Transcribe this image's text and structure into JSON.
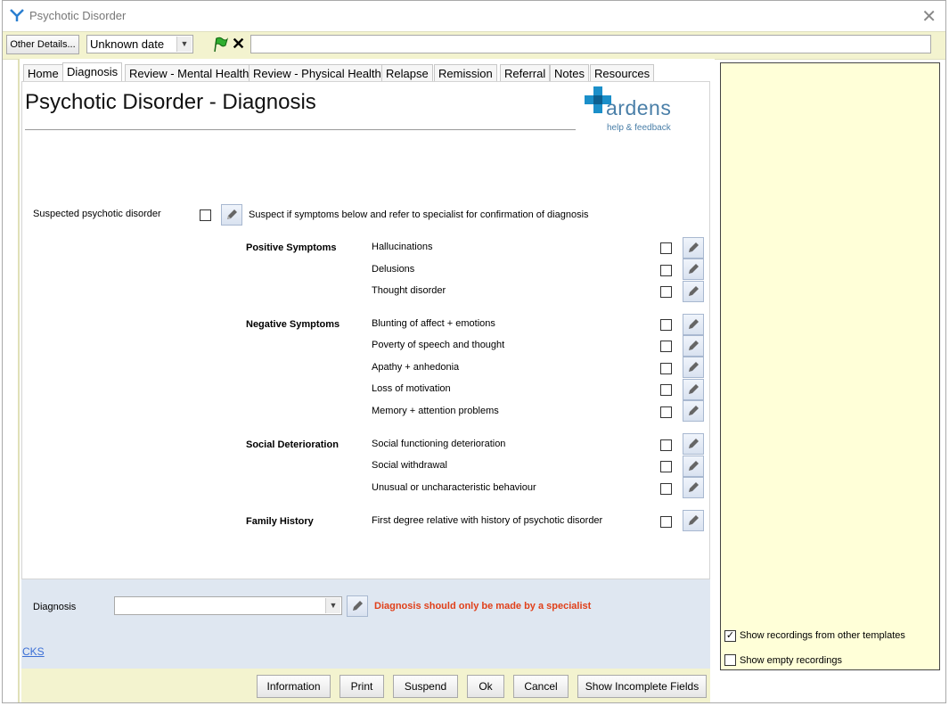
{
  "window": {
    "title": "Psychotic Disorder"
  },
  "toolbar": {
    "other_details_label": "Other Details...",
    "date_value": "Unknown date",
    "free_text_value": ""
  },
  "tabs": [
    {
      "label": "Home"
    },
    {
      "label": "Diagnosis"
    },
    {
      "label": "Review - Mental Health"
    },
    {
      "label": "Review - Physical Health"
    },
    {
      "label": "Relapse"
    },
    {
      "label": "Remission"
    },
    {
      "label": "Referral"
    },
    {
      "label": "Notes"
    },
    {
      "label": "Resources"
    }
  ],
  "active_tab": "Diagnosis",
  "page": {
    "title": "Psychotic Disorder - Diagnosis",
    "logo_text": "ardens",
    "logo_link": "help & feedback",
    "logo_color": "#4a7fa8",
    "logo_accent": "#1b8fc9"
  },
  "suspected": {
    "label": "Suspected psychotic disorder",
    "hint": "Suspect if symptoms below and refer to specialist for confirmation of diagnosis"
  },
  "groups": [
    {
      "name": "Positive Symptoms",
      "items": [
        "Hallucinations",
        "Delusions",
        "Thought disorder"
      ]
    },
    {
      "name": "Negative Symptoms",
      "items": [
        "Blunting of affect + emotions",
        "Poverty of speech and thought",
        "Apathy + anhedonia",
        "Loss of motivation",
        "Memory + attention problems"
      ]
    },
    {
      "name": "Social Deterioration",
      "items": [
        "Social functioning deterioration",
        "Social withdrawal",
        "Unusual or uncharacteristic behaviour"
      ]
    },
    {
      "name": "Family History",
      "items": [
        "First degree relative with history of psychotic disorder"
      ]
    }
  ],
  "diagnosis": {
    "label": "Diagnosis",
    "value": "",
    "warning": "Diagnosis should only be made by a specialist",
    "warning_color": "#e0401a"
  },
  "cks_link": "CKS",
  "bottom_buttons": [
    {
      "label": "Information"
    },
    {
      "label": "Print"
    },
    {
      "label": "Suspend"
    },
    {
      "label": "Ok"
    },
    {
      "label": "Cancel"
    },
    {
      "label": "Show Incomplete Fields"
    }
  ],
  "right_panel": {
    "show_other_templates": {
      "label": "Show recordings from other templates",
      "checked": true
    },
    "show_empty": {
      "label": "Show empty recordings",
      "checked": false
    }
  }
}
